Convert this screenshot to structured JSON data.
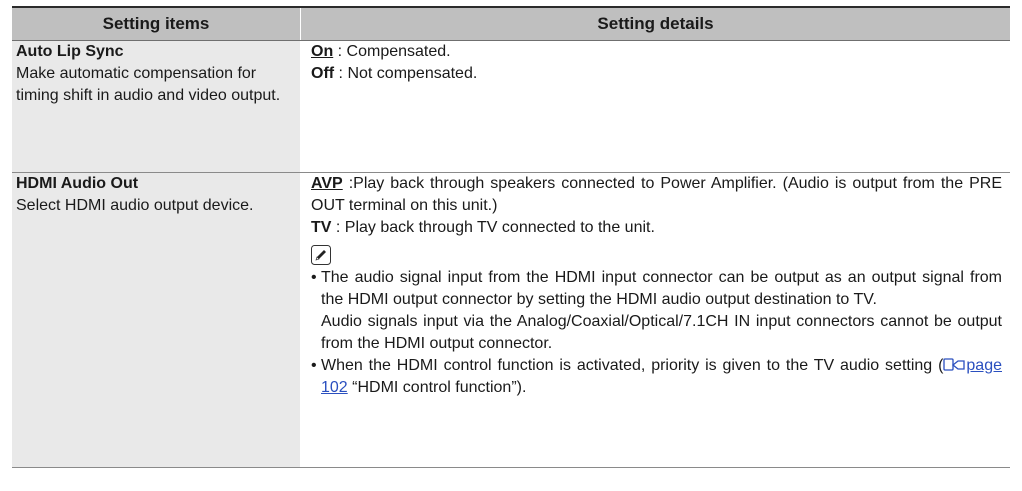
{
  "table": {
    "header": {
      "col1": "Setting items",
      "col2": "Setting details"
    },
    "rows": [
      {
        "title": "Auto Lip Sync",
        "description": "Make automatic compensation for timing shift in audio and video output.",
        "options": [
          {
            "key": "On",
            "text": " : Compensated."
          },
          {
            "key": "Off",
            "text": " : Not compensated."
          }
        ]
      },
      {
        "title": "HDMI Audio Out",
        "description": "Select HDMI audio output device.",
        "options": [
          {
            "key": "AVP",
            "text": " :Play back through speakers connected to Power Amplifier. (Audio is output from the PRE OUT terminal on this unit.)"
          },
          {
            "key": "TV",
            "text": " : Play back through TV connected to the unit."
          }
        ],
        "notes": [
          {
            "bullet": "•",
            "p1": "The audio signal input from the HDMI input connector can be output as an output signal from the HDMI output connector by setting the HDMI audio output destination to TV.",
            "p2": "Audio signals input via the Analog/Coaxial/Optical/7.1CH IN input connectors cannot be output from the HDMI output connector."
          },
          {
            "bullet": "•",
            "text_before": "When the HDMI control function is activated, priority is given to the TV audio setting (",
            "link": "page 102",
            "text_after": " “HDMI control function”)."
          }
        ]
      }
    ]
  },
  "icons": {
    "note": "pencil-icon",
    "reference": "page-reference-icon"
  },
  "colors": {
    "header_bg": "#bfbfbf",
    "item_col_bg": "#e9e9e9",
    "link": "#2a4fbf"
  }
}
